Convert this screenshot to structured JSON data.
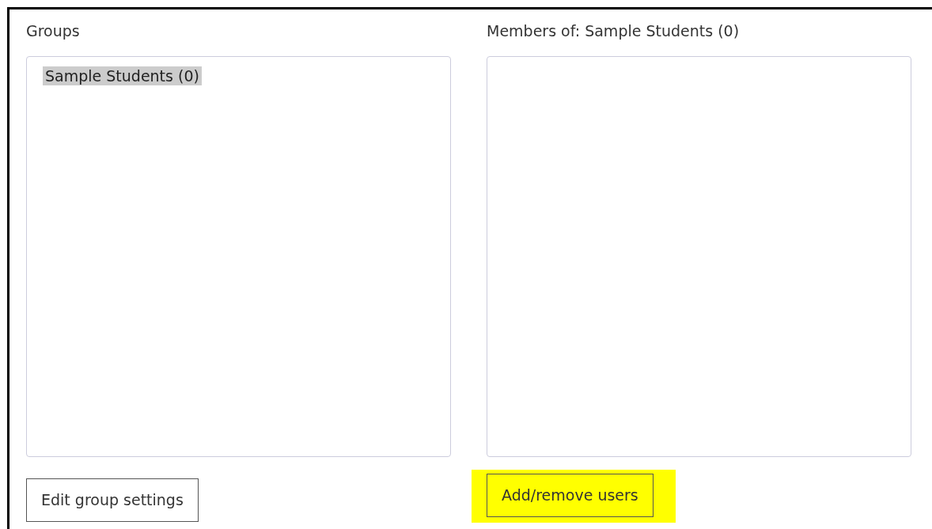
{
  "groups_panel": {
    "label": "Groups",
    "items": [
      {
        "label": "Sample Students (0)",
        "selected": true
      }
    ]
  },
  "members_panel": {
    "label": "Members of: Sample Students (0)"
  },
  "buttons": [
    {
      "label": "Edit group settings",
      "highlighted": false
    },
    {
      "label": "Add/remove users",
      "highlighted": true
    }
  ]
}
